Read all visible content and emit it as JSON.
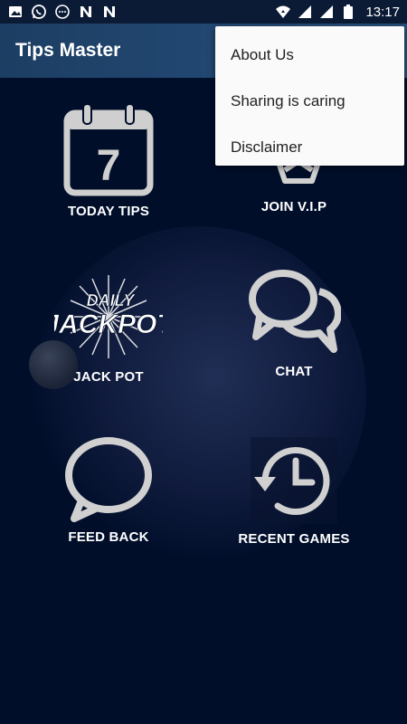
{
  "status_bar": {
    "time": "13:17",
    "left_icons": [
      "image-icon",
      "whatsapp-icon",
      "message-icon",
      "n-icon",
      "n-icon"
    ],
    "right_icons": [
      "wifi-icon",
      "signal-icon",
      "signal-icon",
      "battery-icon"
    ]
  },
  "app_bar": {
    "title": "Tips Master"
  },
  "tiles": [
    {
      "label": "TODAY TIPS",
      "icon": "calendar-icon",
      "number": "7"
    },
    {
      "label": "JOIN V.I.P",
      "icon": "vip-icon"
    },
    {
      "label": "JACK POT",
      "icon": "jackpot-logo",
      "logo_top": "DAILY",
      "logo_bottom": "JACKPOT"
    },
    {
      "label": "CHAT",
      "icon": "chat-bubbles-icon"
    },
    {
      "label": "FEED BACK",
      "icon": "speech-bubble-icon"
    },
    {
      "label": "RECENT GAMES",
      "icon": "history-clock-icon"
    }
  ],
  "menu": {
    "items": [
      "About Us",
      "Sharing is caring",
      "Disclaimer"
    ]
  },
  "colors": {
    "background": "#000e2a",
    "app_bar": "#26507e",
    "icon_gray": "#d0d0d0",
    "menu_bg": "#fafafa"
  }
}
